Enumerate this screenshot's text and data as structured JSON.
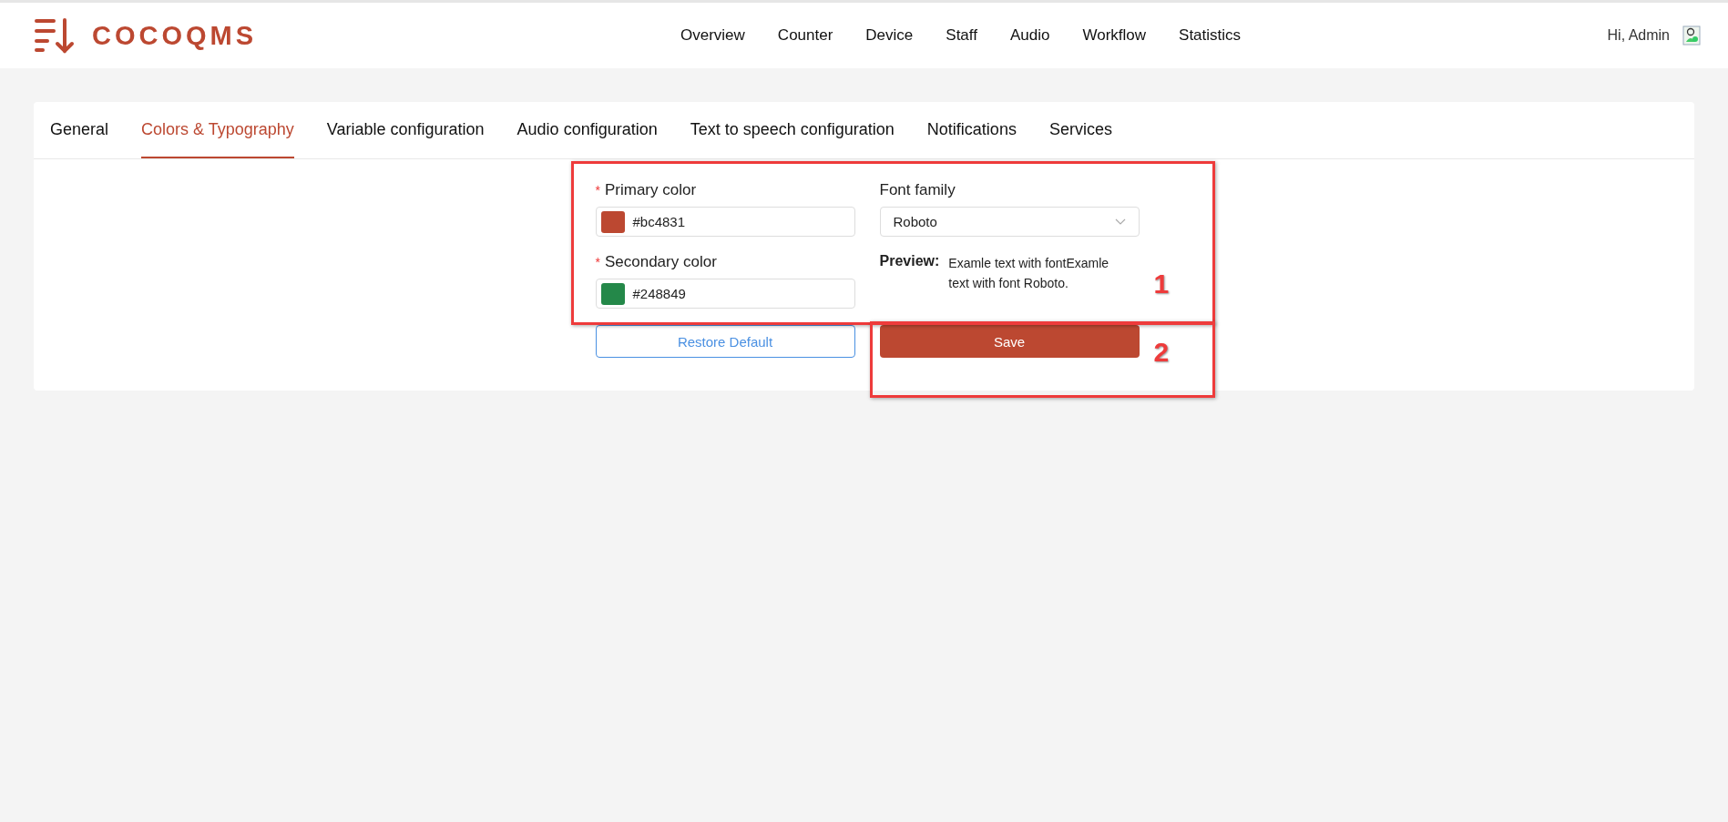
{
  "header": {
    "logo_text": "COCOQMS",
    "nav": [
      {
        "label": "Overview"
      },
      {
        "label": "Counter"
      },
      {
        "label": "Device"
      },
      {
        "label": "Staff"
      },
      {
        "label": "Audio"
      },
      {
        "label": "Workflow"
      },
      {
        "label": "Statistics"
      }
    ],
    "greeting": "Hi, Admin"
  },
  "tabs": [
    {
      "label": "General",
      "selected": false
    },
    {
      "label": "Colors & Typography",
      "selected": true
    },
    {
      "label": "Variable configuration",
      "selected": false
    },
    {
      "label": "Audio configuration",
      "selected": false
    },
    {
      "label": "Text to speech configuration",
      "selected": false
    },
    {
      "label": "Notifications",
      "selected": false
    },
    {
      "label": "Services",
      "selected": false
    }
  ],
  "form": {
    "colors": [
      {
        "label": "Primary color",
        "required": true,
        "value": "#bc4831",
        "color": "#bc4831"
      },
      {
        "label": "Secondary color",
        "required": true,
        "value": "#248849",
        "color": "#248849"
      }
    ],
    "required_mark": "*",
    "font_family": {
      "label": "Font family",
      "value": "Roboto"
    },
    "preview": {
      "label": "Preview:",
      "text": "Examle text with fontExamle text with font Roboto."
    },
    "restore_button": "Restore Default",
    "save_button": "Save"
  },
  "annotations": [
    {
      "label": "1"
    },
    {
      "label": "2"
    }
  ]
}
